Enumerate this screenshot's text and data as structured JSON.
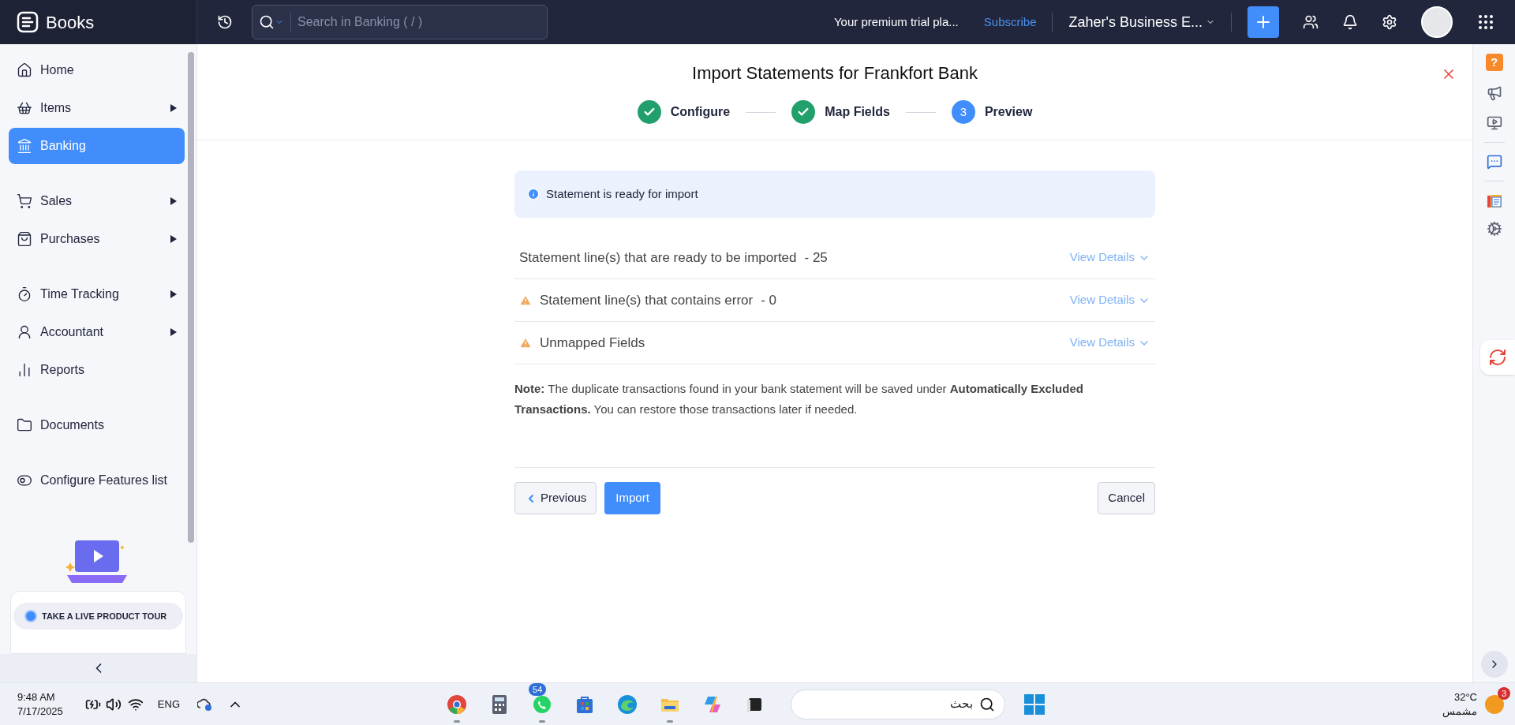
{
  "topbar": {
    "brand": "Books",
    "search": {
      "placeholder": "Search in Banking ( / )"
    },
    "trial": "Your premium trial pla...",
    "subscribe": "Subscribe",
    "org": "Zaher's Business E..."
  },
  "sidebar": {
    "groups": [
      [
        {
          "label": "Home",
          "selected": false,
          "has_submenu": false
        },
        {
          "label": "Items",
          "selected": false,
          "has_submenu": true
        },
        {
          "label": "Banking",
          "selected": true,
          "has_submenu": false
        }
      ],
      [
        {
          "label": "Sales",
          "selected": false,
          "has_submenu": true
        },
        {
          "label": "Purchases",
          "selected": false,
          "has_submenu": true
        }
      ],
      [
        {
          "label": "Time Tracking",
          "selected": false,
          "has_submenu": true
        },
        {
          "label": "Accountant",
          "selected": false,
          "has_submenu": true
        },
        {
          "label": "Reports",
          "selected": false,
          "has_submenu": false
        }
      ],
      [
        {
          "label": "Documents",
          "selected": false,
          "has_submenu": false
        }
      ],
      [
        {
          "label": "Configure Features list",
          "selected": false,
          "has_submenu": false
        }
      ]
    ],
    "tour_button": "TAKE A LIVE PRODUCT TOUR"
  },
  "dialog": {
    "title": "Import Statements for Frankfort Bank",
    "steps": [
      {
        "label": "Configure",
        "completed": true
      },
      {
        "label": "Map Fields",
        "completed": true
      },
      {
        "label": "Preview",
        "completed": false,
        "number": "3"
      }
    ],
    "info": "Statement is ready for import",
    "rows": [
      {
        "kind": "plain",
        "text": "Statement line(s) that are ready to be imported",
        "count": "- 25",
        "link": "View Details"
      },
      {
        "kind": "warning",
        "text": "Statement line(s) that contains error",
        "count": "- 0",
        "link": "View Details"
      },
      {
        "kind": "warning",
        "text": "Unmapped Fields",
        "link": "View Details"
      }
    ],
    "note": "**Note:** The duplicate transactions found in your bank statement will be saved under **Automatically Excluded Transactions.** You can restore those transactions later if needed.",
    "buttons": {
      "previous": "Previous",
      "import": "Import",
      "cancel": "Cancel"
    }
  },
  "right_rail": {
    "help": "?"
  },
  "taskbar": {
    "time": "9:48 AM",
    "date": "7/17/2025",
    "language": "ENG",
    "whatsapp_badge": "54",
    "search": {
      "placeholder": "بحث"
    },
    "temperature": "32°C",
    "weather": "مشمس",
    "weather_badge": "3"
  }
}
